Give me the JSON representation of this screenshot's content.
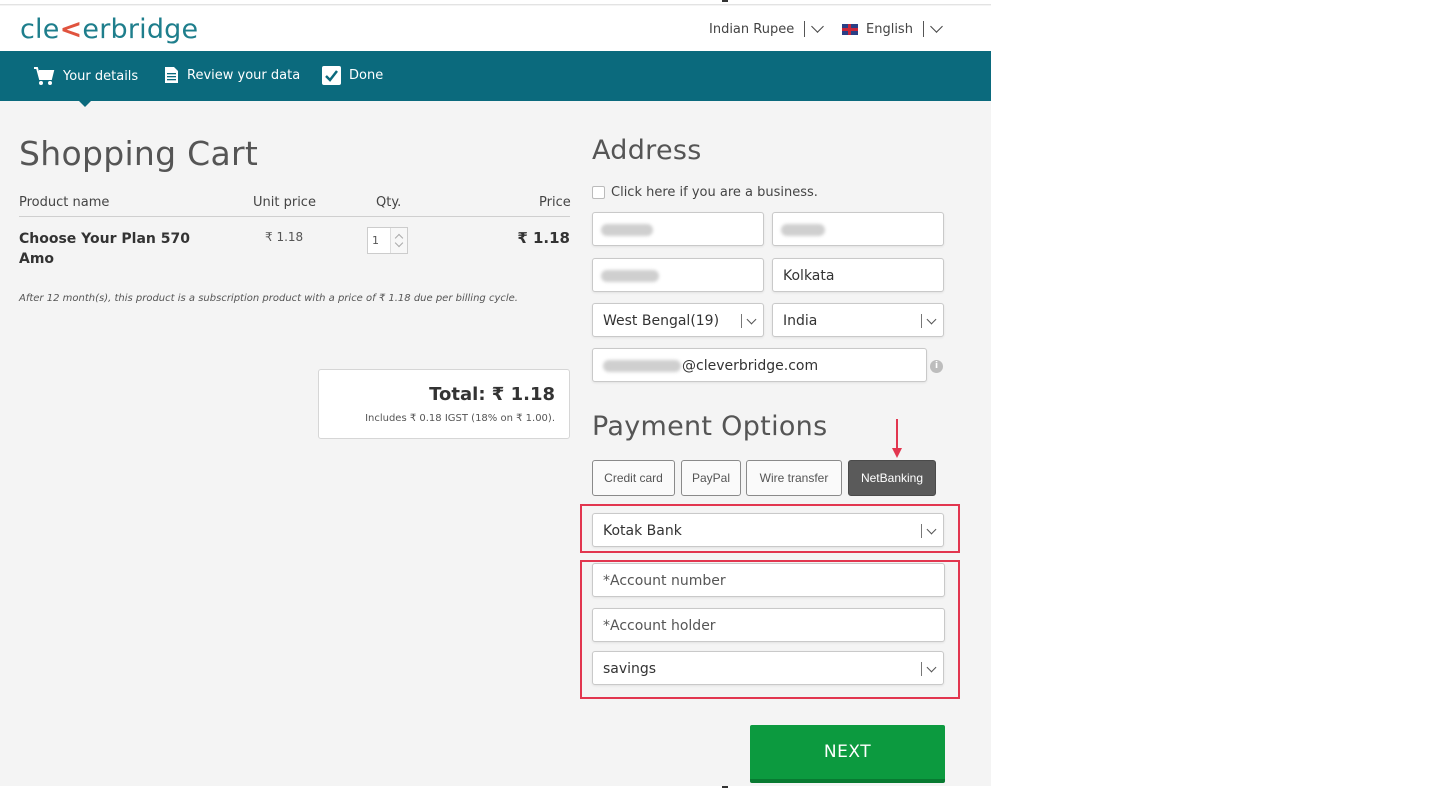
{
  "header": {
    "logo_text_1": "cle",
    "logo_text_2": "erbridge",
    "currency": "Indian Rupee",
    "language": "English"
  },
  "steps": [
    {
      "label": "Your details",
      "icon": "cart-icon",
      "active": true
    },
    {
      "label": "Review your data",
      "icon": "document-icon",
      "active": false
    },
    {
      "label": "Done",
      "icon": "checkbox-icon",
      "active": false
    }
  ],
  "cart": {
    "title": "Shopping Cart",
    "columns": {
      "product": "Product name",
      "unit_price": "Unit price",
      "qty": "Qty.",
      "price": "Price"
    },
    "item": {
      "name": "Choose Your Plan 570 Amo",
      "unit_price": "₹ 1.18",
      "qty": "1",
      "price": "₹ 1.18"
    },
    "subscription_note": "After 12 month(s), this product is a subscription product with a price of ₹ 1.18 due per billing cycle.",
    "total": "Total: ₹ 1.18",
    "tax_note": "Includes ₹ 0.18 IGST (18% on ₹ 1.00)."
  },
  "address": {
    "title": "Address",
    "business_label": "Click here if you are a business.",
    "city": "Kolkata",
    "state": "West Bengal(19)",
    "country": "India",
    "email_suffix": "@cleverbridge.com"
  },
  "payment": {
    "title": "Payment Options",
    "methods": [
      "Credit card",
      "PayPal",
      "Wire transfer",
      "NetBanking"
    ],
    "active_method": "NetBanking",
    "bank": "Kotak Bank",
    "account_number_placeholder": "*Account number",
    "account_holder_placeholder": "*Account holder",
    "account_type": "savings"
  },
  "next_label": "NEXT",
  "colors": {
    "brand_teal": "#0b6a7d",
    "next_green": "#0c9a3f",
    "highlight_red": "#e2364f"
  }
}
